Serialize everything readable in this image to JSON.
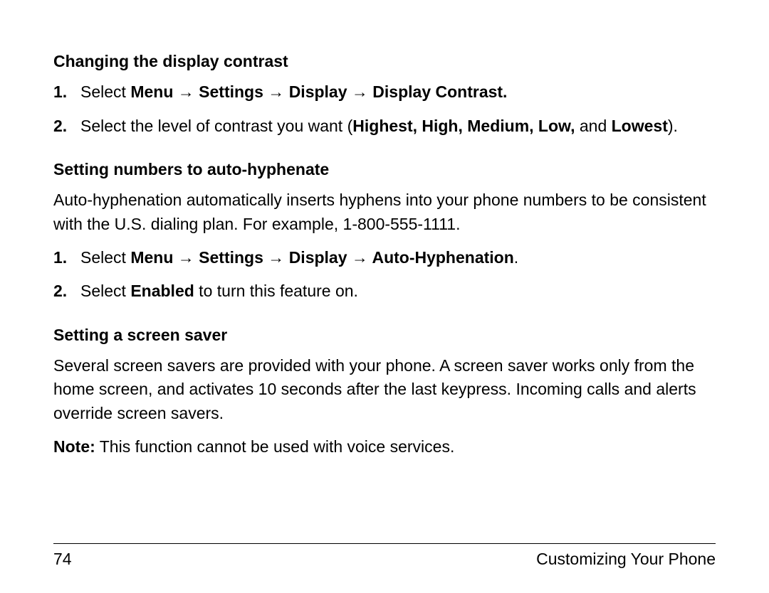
{
  "section1": {
    "heading": "Changing the display contrast",
    "step1_num": "1.",
    "step1_prefix": "Select ",
    "step1_path1": "Menu",
    "step1_arrow": " → ",
    "step1_path2": "Settings",
    "step1_path3": "Display",
    "step1_path4": "Display Contrast.",
    "step2_num": "2.",
    "step2_prefix": "Select the level of contrast you want (",
    "step2_bold": "Highest, High, Medium, Low, ",
    "step2_mid": "and ",
    "step2_bold2": "Lowest",
    "step2_suffix": ")."
  },
  "section2": {
    "heading": "Setting numbers to auto-hyphenate",
    "para": "Auto-hyphenation automatically inserts hyphens into your phone numbers to be consistent with the U.S. dialing plan. For example, 1-800-555-1111.",
    "step1_num": "1.",
    "step1_prefix": "Select ",
    "step1_path1": "Menu",
    "step1_arrow": " → ",
    "step1_path2": "Settings",
    "step1_path3": "Display",
    "step1_path4": "Auto-Hyphenation",
    "step1_suffix": ".",
    "step2_num": "2.",
    "step2_prefix": "Select ",
    "step2_bold": "Enabled",
    "step2_suffix": " to turn this feature on."
  },
  "section3": {
    "heading": "Setting a screen saver",
    "para": "Several screen savers are provided with your phone. A screen saver works only from the home screen, and activates 10 seconds after the last keypress. Incoming calls and alerts override screen savers.",
    "note_label": "Note:",
    "note_text": " This function cannot be used with voice services."
  },
  "footer": {
    "page_num": "74",
    "doc_title": "Customizing Your Phone"
  }
}
